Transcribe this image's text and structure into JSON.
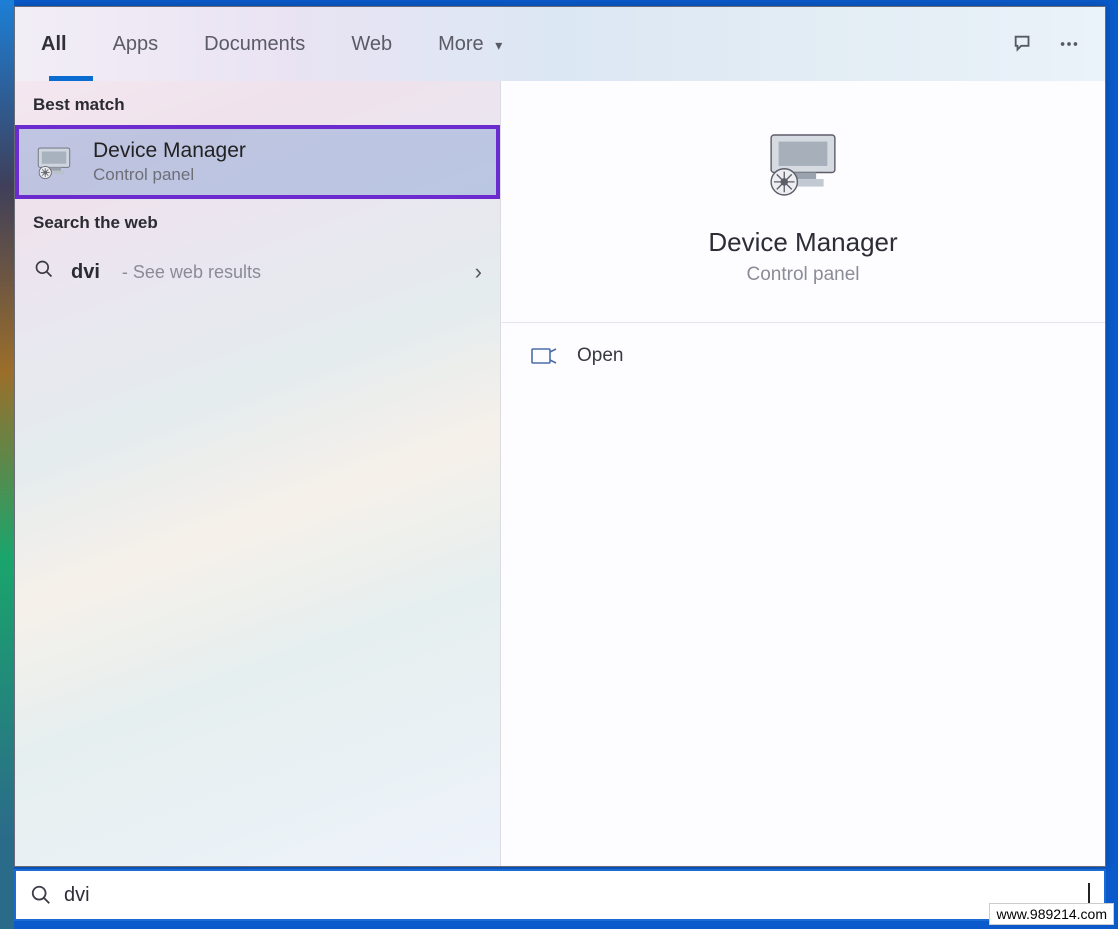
{
  "tabs": {
    "all": "All",
    "apps": "Apps",
    "documents": "Documents",
    "web": "Web",
    "more": "More"
  },
  "sections": {
    "best_match": "Best match",
    "search_web": "Search the web"
  },
  "best_match": {
    "title": "Device Manager",
    "subtitle": "Control panel"
  },
  "web_result": {
    "query": "dvi",
    "hint": "See web results"
  },
  "preview": {
    "title": "Device Manager",
    "subtitle": "Control panel"
  },
  "actions": {
    "open": "Open"
  },
  "search": {
    "value": "dvi"
  },
  "watermark": "www.989214.com"
}
